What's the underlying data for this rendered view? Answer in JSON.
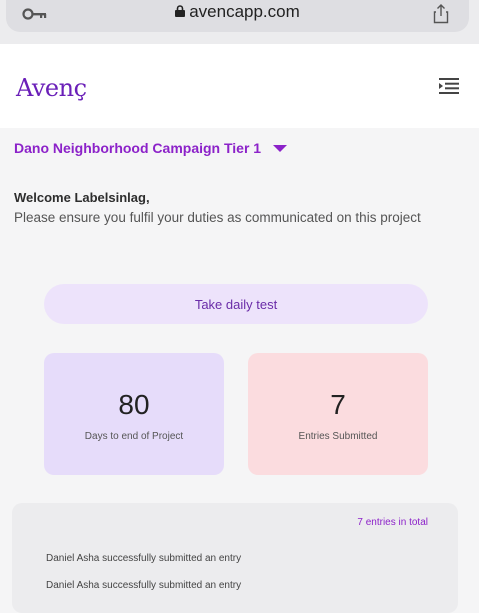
{
  "browser": {
    "url": "avencapp.com",
    "icons": [
      "key-icon",
      "lock-icon",
      "share-icon"
    ]
  },
  "header": {
    "logo": "Avenç",
    "menu_icon": "menu-icon"
  },
  "campaign": {
    "title": "Dano Neighborhood Campaign Tier 1"
  },
  "welcome": {
    "greeting": "Welcome Labelsinlag,",
    "message": "Please ensure you fulfil your duties as communicated on this project"
  },
  "actions": {
    "daily_test_label": "Take daily test"
  },
  "stats": {
    "days_value": "80",
    "days_label": "Days to end of Project",
    "entries_value": "7",
    "entries_label": "Entries Submitted"
  },
  "activity": {
    "total_label": "7 entries in total",
    "entries": [
      "Daniel Asha successfully submitted an entry",
      "Daniel Asha successfully submitted an entry"
    ]
  },
  "colors": {
    "brand": "#8c22c9",
    "card_purple": "#e6dcfa",
    "card_pink": "#fbdcdf",
    "button_bg": "#ede3fb"
  }
}
